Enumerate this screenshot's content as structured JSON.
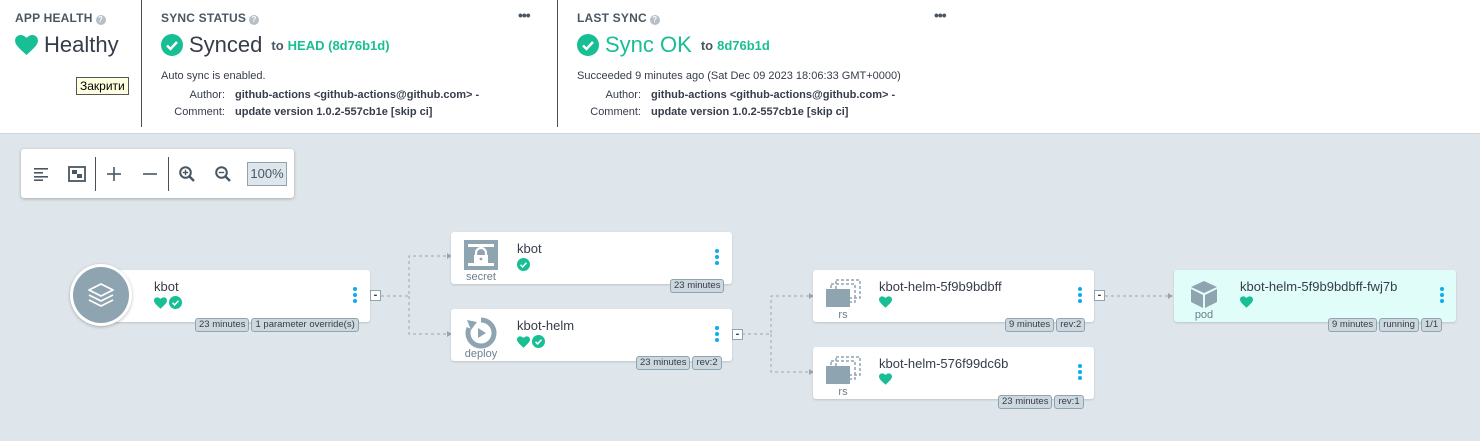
{
  "app_health": {
    "title": "APP HEALTH",
    "status": "Healthy",
    "tooltip": "Закрити"
  },
  "sync_status": {
    "title": "SYNC STATUS",
    "status": "Synced",
    "to_label": "to",
    "revision": "HEAD (8d76b1d)",
    "auto_sync": "Auto sync is enabled.",
    "author_label": "Author:",
    "author": "github-actions <github-actions@github.com> -",
    "comment_label": "Comment:",
    "comment": "update version 1.0.2-557cb1e [skip ci]"
  },
  "last_sync": {
    "title": "LAST SYNC",
    "status": "Sync OK",
    "to_label": "to",
    "revision": "8d76b1d",
    "succeeded": "Succeeded 9 minutes ago (Sat Dec 09 2023 18:06:33 GMT+0000)",
    "author_label": "Author:",
    "author": "github-actions <github-actions@github.com> -",
    "comment_label": "Comment:",
    "comment": "update version 1.0.2-557cb1e [skip ci]"
  },
  "menu_label": "•••",
  "toolbar": {
    "zoom": "100%"
  },
  "colors": {
    "healthy": "#18be94",
    "accent": "#0dadea",
    "background": "#dee6eb"
  },
  "nodes": {
    "app": {
      "name": "kbot",
      "tags": [
        "23 minutes",
        "1 parameter override(s)"
      ]
    },
    "secret": {
      "kind": "secret",
      "name": "kbot",
      "tags": [
        "23 minutes"
      ]
    },
    "deploy": {
      "kind": "deploy",
      "name": "kbot-helm",
      "tags": [
        "23 minutes",
        "rev:2"
      ]
    },
    "rs1": {
      "kind": "rs",
      "name": "kbot-helm-5f9b9bdbff",
      "tags": [
        "9 minutes",
        "rev:2"
      ]
    },
    "rs2": {
      "kind": "rs",
      "name": "kbot-helm-576f99dc6b",
      "tags": [
        "23 minutes",
        "rev:1"
      ]
    },
    "pod": {
      "kind": "pod",
      "name": "kbot-helm-5f9b9bdbff-fwj7b",
      "tags": [
        "9 minutes",
        "running",
        "1/1"
      ]
    }
  },
  "collapse_symbol": "-"
}
